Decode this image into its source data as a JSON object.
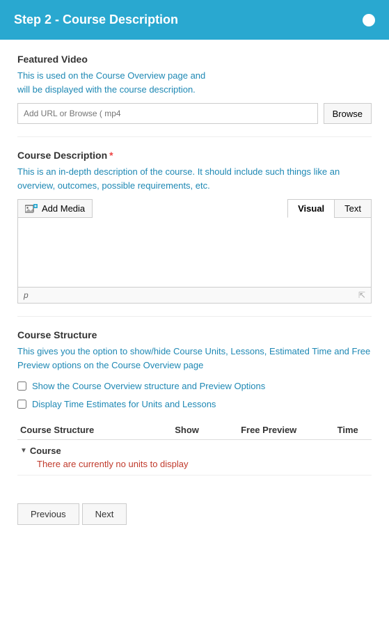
{
  "header": {
    "title": "Step 2 - Course Description",
    "circle_label": "indicator"
  },
  "featured_video": {
    "section_title": "Featured Video",
    "description_line1": "This is used on the Course Overview page and",
    "description_line2": "will be displayed with the course description.",
    "url_placeholder": "Add URL or Browse ( mp4",
    "browse_btn_label": "Browse"
  },
  "course_description": {
    "section_title": "Course Description",
    "required": "*",
    "description": "This is an in-depth description of the course. It should include such things like an overview, outcomes, possible requirements, etc.",
    "add_media_label": "Add Media",
    "tab_visual": "Visual",
    "tab_text": "Text",
    "editor_tag": "p"
  },
  "course_structure": {
    "section_title": "Course Structure",
    "description": "This gives you the option to show/hide Course Units, Lessons, Estimated Time and Free Preview options on the Course Overview page",
    "checkbox1_label": "Show the Course Overview structure and Preview Options",
    "checkbox2_label": "Display Time Estimates for Units and Lessons",
    "table_headers": {
      "col1": "Course Structure",
      "col2": "Show",
      "col3": "Free Preview",
      "col4": "Time"
    },
    "course_label": "Course",
    "no_units_msg": "There are currently no units to display"
  },
  "footer": {
    "previous_label": "Previous",
    "next_label": "Next"
  }
}
